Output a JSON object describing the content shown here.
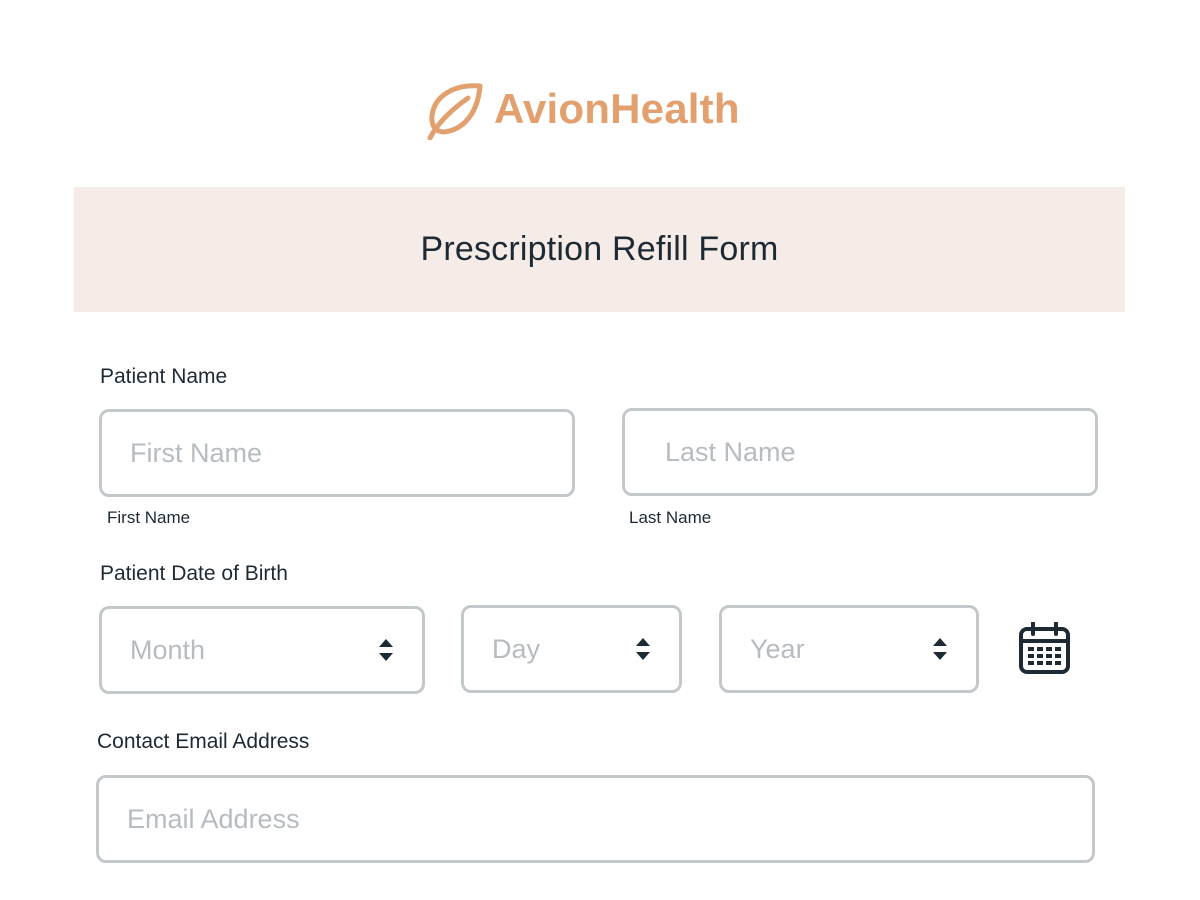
{
  "brand": {
    "name": "AvionHealth",
    "icon": "leaf-icon",
    "color": "#e3a06f"
  },
  "form": {
    "title": "Prescription Refill Form",
    "header_bg": "#f6ece7"
  },
  "patient_name": {
    "label": "Patient Name",
    "first_name": {
      "placeholder": "First Name",
      "value": "",
      "sublabel": "First Name"
    },
    "last_name": {
      "placeholder": "Last Name",
      "value": "",
      "sublabel": "Last Name"
    }
  },
  "dob": {
    "label": "Patient Date of Birth",
    "month": {
      "placeholder": "Month",
      "icon": "sort-arrows-icon"
    },
    "day": {
      "placeholder": "Day",
      "icon": "sort-arrows-icon"
    },
    "year": {
      "placeholder": "Year",
      "icon": "sort-arrows-icon"
    },
    "calendar_icon": "calendar-icon"
  },
  "email": {
    "label": "Contact Email Address",
    "placeholder": "Email Address",
    "value": ""
  }
}
